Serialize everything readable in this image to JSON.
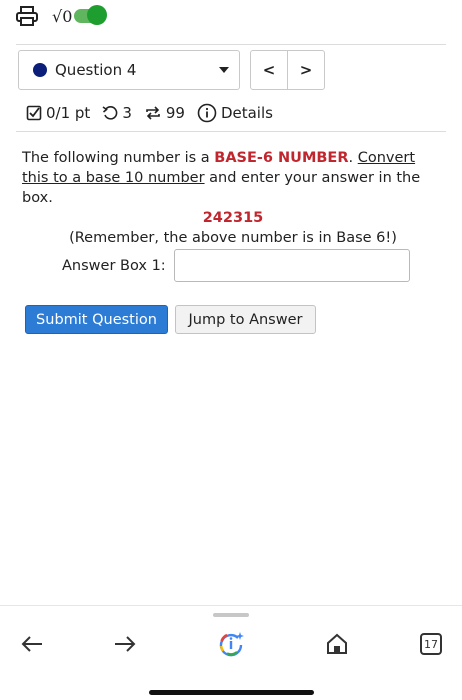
{
  "toolbar": {
    "print_icon": "printer-icon",
    "math_label": "√0",
    "math_toggle_on": true
  },
  "question_nav": {
    "selected": "Question 4",
    "status_color": "#0a1e7a",
    "prev": "<",
    "next": ">"
  },
  "meta": {
    "points": "0/1 pt",
    "retries": "3",
    "attempts": "99",
    "details": "Details"
  },
  "question": {
    "text_1": "The following number is a ",
    "highlight": "BASE-6 NUMBER",
    "text_2": ". ",
    "link": "Convert this to a base 10 number",
    "text_3": " and enter your answer in the box.",
    "number": "242315",
    "reminder": "(Remember, the above number is in Base 6!)"
  },
  "answer": {
    "label": "Answer Box 1:",
    "value": ""
  },
  "buttons": {
    "submit": "Submit Question",
    "jump": "Jump to Answer"
  },
  "browser": {
    "tab_count": "17"
  },
  "colors": {
    "accent": "#2c7cd6",
    "highlight": "#c0262d",
    "toggle_on": "#1e9e2e"
  }
}
